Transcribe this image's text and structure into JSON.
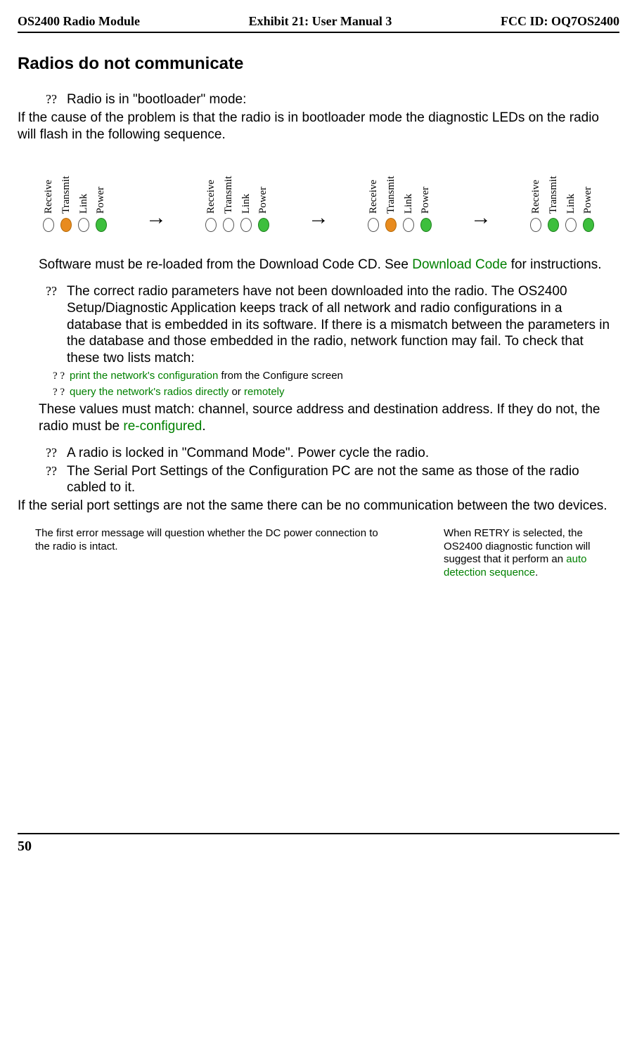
{
  "header": {
    "left": "OS2400 Radio Module",
    "center": "Exhibit 21: User Manual 3",
    "right": "FCC ID: OQ7OS2400"
  },
  "title": "Radios do not communicate",
  "bullet1_mark": "??",
  "bullet1_text": "Radio is in \"bootloader\" mode:",
  "para1": "If the cause of the problem is that the radio is in bootloader mode the diagnostic LEDs on the radio will flash in the following sequence.",
  "led_labels": {
    "receive": "Receive",
    "transmit": "Transmit",
    "link": "Link",
    "power": "Power"
  },
  "para2_pre": "Software must be re-loaded from the Download Code CD.  See ",
  "para2_link": "Download Code",
  "para2_post": " for instructions.",
  "bullet2_mark": "??",
  "bullet2_text": "The correct radio parameters have not been downloaded into the radio.  The OS2400 Setup/Diagnostic Application keeps track of all network and radio configurations in a database that is embedded in its software.  If there is a mismatch between the parameters in the database and those embedded in the radio, network function may fail.  To check that these two lists match:",
  "sub1_mark": "? ?",
  "sub1_link": "print the network's configuration",
  "sub1_rest": " from the Configure screen",
  "sub2_mark": "? ?",
  "sub2_link1": "query the network's radios directly",
  "sub2_mid": " or ",
  "sub2_link2": "remotely",
  "para3_pre": "These values must match: channel, source address and destination address.  If they do not, the radio must be ",
  "para3_link": "re-configured",
  "para3_post": ".",
  "bullet3_mark": "??",
  "bullet3_text": "A radio is locked in \"Command Mode\".  Power cycle the radio.",
  "bullet4_mark": "??",
  "bullet4_text": "The Serial Port Settings of the Configuration PC are not the same as those of the radio cabled to it.",
  "para4": "If the serial port settings are not the same there can be no communication between the two devices.",
  "col_left": "The first error message will question whether the DC power connection to the radio is intact.",
  "col_right_pre": "When RETRY is selected, the OS2400 diagnostic function will suggest that it perform an ",
  "col_right_link": "auto detection sequence",
  "col_right_post": ".",
  "page_number": "50"
}
